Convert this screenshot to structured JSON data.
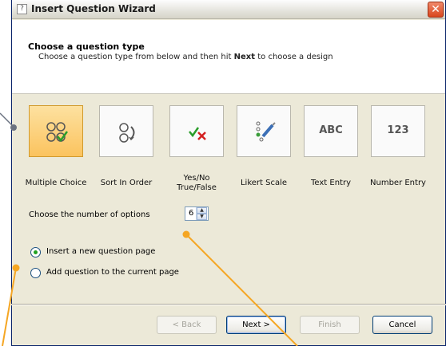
{
  "window": {
    "title": "Insert Question Wizard",
    "close_glyph": "✕"
  },
  "header": {
    "title": "Choose a question type",
    "subtitle_before": "Choose a question type from below and then hit ",
    "subtitle_bold": "Next",
    "subtitle_after": " to choose a design"
  },
  "question_types": [
    {
      "label": "Multiple Choice",
      "icon": "multiple-choice-icon",
      "selected": true
    },
    {
      "label": "Sort In Order",
      "icon": "sort-order-icon",
      "selected": false
    },
    {
      "label": "Yes/No True/False",
      "icon": "yes-no-icon",
      "selected": false
    },
    {
      "label": "Likert Scale",
      "icon": "likert-icon",
      "selected": false
    },
    {
      "label": "Text Entry",
      "icon": "text-entry-icon",
      "tile_text": "ABC",
      "selected": false
    },
    {
      "label": "Number Entry",
      "icon": "number-entry-icon",
      "tile_text": "123",
      "selected": false
    }
  ],
  "labels": {
    "yes_no_line1": "Yes/No",
    "yes_no_line2": "True/False"
  },
  "options": {
    "label": "Choose the number of options",
    "value": "6"
  },
  "page_choice": {
    "insert_new": "Insert a new question page",
    "add_current": "Add question to the current page",
    "selected": "insert_new"
  },
  "buttons": {
    "back": "< Back",
    "next": "Next >",
    "finish": "Finish",
    "cancel": "Cancel"
  },
  "colors": {
    "callout": "#f5a623",
    "selected_tile": "#fbc35e",
    "window_bg": "#ece9d8"
  }
}
